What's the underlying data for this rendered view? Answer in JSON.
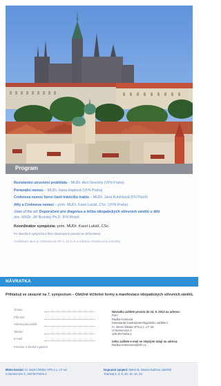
{
  "program": {
    "heading": "Program",
    "talks": [
      {
        "title": "Rezistentní ulcerózní proktitida",
        "speaker": " – MUDr. Aleš Novotný (VFN Praha)"
      },
      {
        "title": "Perianální nemoc",
        "speaker": " – MUDr. Hana Hajdová (VFN Praha)"
      },
      {
        "title": "Crohnova nemoc horní části trávicího traktu",
        "speaker": " – MUDr. Jana Kubíčková (FN Plzeň)"
      },
      {
        "title": "Afty a Crohnova nemoc",
        "speaker": " – prim. MUDr. Karel Lukáš, CSc. (VFN Praha)"
      }
    ],
    "talk5_title": "State of the art: ",
    "talk5_title_bold": "Doporučení pro diagnózu a léčbu idiopatických střevních zánětů u dětí",
    "talk5_speaker": "doc. MUDr. Jiří Bronský Ph.D. (FN Motol)",
    "coordinator_label": "Koordinátor sympózia:",
    "coordinator_name": " prim. MUDr. Karel Lukáš, CSc.",
    "note1": "Po skončení sympózia a fáze dotazujeme pozvat na občerstvení.",
    "note2": "Vzdělávací akce je zařazena do SP 2, 16 ČLK a získat je ohodnocena 2 kredity."
  },
  "return_slip": {
    "heading": "NÁVRATKA",
    "invite": "Přihlašuji se závazně na 7. sympozium – Obtížně léčitelné formy a manifestace idiopatických střevních zánětů.",
    "fields": [
      "Jméno",
      "Příjmení",
      "Adresa pracoviště",
      "Telefon",
      "E-mail"
    ],
    "fields_note": "Prosíme o čitelné vyplnění",
    "addr_heading": "Návratku zašlete prosím do 24. 5. 2013 na adresu:",
    "addr_lines": [
      "Paní",
      "Radka Hotmoná",
      "Sekretariát Gastroenterologického oddělení",
      "IV. interní klinika VFN a 1. LF UK",
      "U Nemocnice 2",
      "128 08 Praha 2"
    ],
    "addr_email_heading": "nebo zašlete e-mail se stejnými údaji na adresu:",
    "addr_email": "Radka.Hotmonova@vfn.cz"
  },
  "footer": {
    "venue_label": "Místo konání:",
    "venue_line1": " IV. interní klinika VFN a 1. LF UK",
    "venue_line2": "U Nemocnice 2, 128 08 Praha 2",
    "transport_label": "Dopravní spojení:",
    "transport_line1": " Metro B, stanice Karlovo náměstí",
    "transport_line2": "Tramvaj 3, 4, 6, 10, 14, 16, 24"
  }
}
